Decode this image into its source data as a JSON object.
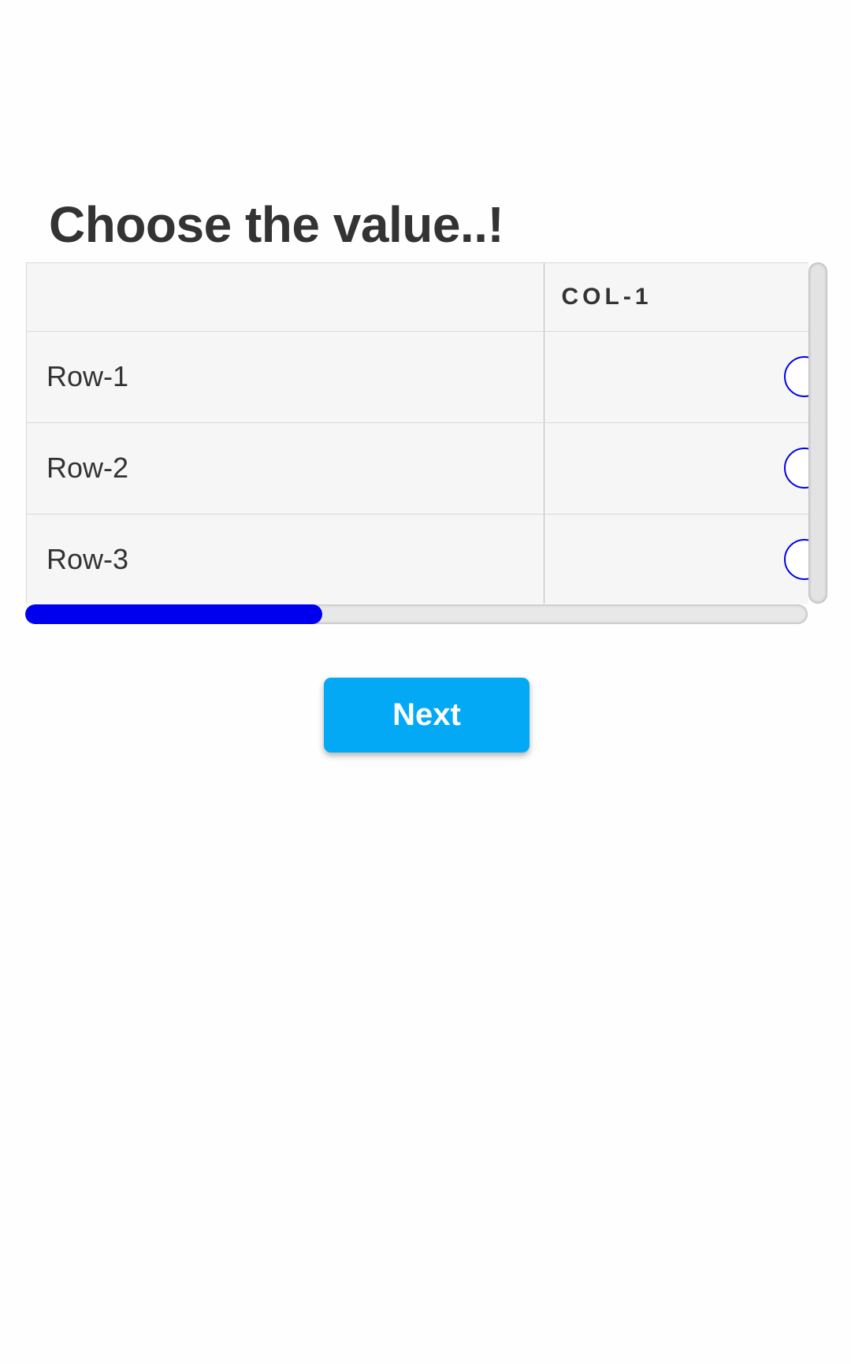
{
  "question": {
    "title": "Choose the value..!"
  },
  "grid": {
    "columns": [
      "",
      "COL-1"
    ],
    "rows": [
      {
        "label": "Row-1",
        "selected": false
      },
      {
        "label": "Row-2",
        "selected": false
      },
      {
        "label": "Row-3",
        "selected": false
      }
    ],
    "horizontal_scroll_fraction": 0.38
  },
  "footer": {
    "next_label": "Next"
  },
  "colors": {
    "radio_border": "#0000ee",
    "scroll_thumb": "#0000ee",
    "next_button": "#03a9f4",
    "title_text": "#333333"
  }
}
